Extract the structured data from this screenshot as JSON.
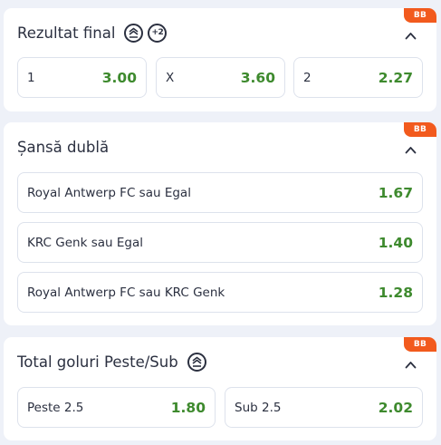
{
  "badge_label": "BB",
  "colors": {
    "background": "#eef1f8",
    "card": "#ffffff",
    "badge": "#f25a1d",
    "odds": "#3e8a2e",
    "text": "#2b3040",
    "border": "#dde2ec"
  },
  "markets": [
    {
      "title": "Rezultat final",
      "icons": [
        "bet-builder-stack-icon",
        "plus-two-icon"
      ],
      "plus_label": "+2",
      "options": [
        {
          "label": "1",
          "odd": "3.00"
        },
        {
          "label": "X",
          "odd": "3.60"
        },
        {
          "label": "2",
          "odd": "2.27"
        }
      ]
    },
    {
      "title": "Șansă dublă",
      "options": [
        {
          "label": "Royal Antwerp FC sau Egal",
          "odd": "1.67"
        },
        {
          "label": "KRC Genk sau Egal",
          "odd": "1.40"
        },
        {
          "label": "Royal Antwerp FC sau KRC Genk",
          "odd": "1.28"
        }
      ]
    },
    {
      "title": "Total goluri Peste/Sub",
      "icons": [
        "bet-builder-stack-icon"
      ],
      "options": [
        {
          "label": "Peste 2.5",
          "odd": "1.80"
        },
        {
          "label": "Sub 2.5",
          "odd": "2.02"
        }
      ]
    }
  ]
}
